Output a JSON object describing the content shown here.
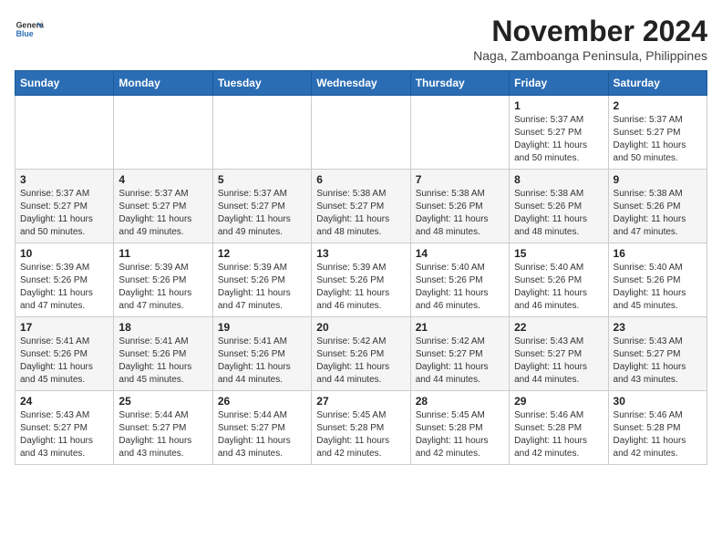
{
  "logo": {
    "general": "General",
    "blue": "Blue"
  },
  "title": "November 2024",
  "subtitle": "Naga, Zamboanga Peninsula, Philippines",
  "days_of_week": [
    "Sunday",
    "Monday",
    "Tuesday",
    "Wednesday",
    "Thursday",
    "Friday",
    "Saturday"
  ],
  "weeks": [
    [
      {
        "day": "",
        "info": ""
      },
      {
        "day": "",
        "info": ""
      },
      {
        "day": "",
        "info": ""
      },
      {
        "day": "",
        "info": ""
      },
      {
        "day": "",
        "info": ""
      },
      {
        "day": "1",
        "info": "Sunrise: 5:37 AM\nSunset: 5:27 PM\nDaylight: 11 hours and 50 minutes."
      },
      {
        "day": "2",
        "info": "Sunrise: 5:37 AM\nSunset: 5:27 PM\nDaylight: 11 hours and 50 minutes."
      }
    ],
    [
      {
        "day": "3",
        "info": "Sunrise: 5:37 AM\nSunset: 5:27 PM\nDaylight: 11 hours and 50 minutes."
      },
      {
        "day": "4",
        "info": "Sunrise: 5:37 AM\nSunset: 5:27 PM\nDaylight: 11 hours and 49 minutes."
      },
      {
        "day": "5",
        "info": "Sunrise: 5:37 AM\nSunset: 5:27 PM\nDaylight: 11 hours and 49 minutes."
      },
      {
        "day": "6",
        "info": "Sunrise: 5:38 AM\nSunset: 5:27 PM\nDaylight: 11 hours and 48 minutes."
      },
      {
        "day": "7",
        "info": "Sunrise: 5:38 AM\nSunset: 5:26 PM\nDaylight: 11 hours and 48 minutes."
      },
      {
        "day": "8",
        "info": "Sunrise: 5:38 AM\nSunset: 5:26 PM\nDaylight: 11 hours and 48 minutes."
      },
      {
        "day": "9",
        "info": "Sunrise: 5:38 AM\nSunset: 5:26 PM\nDaylight: 11 hours and 47 minutes."
      }
    ],
    [
      {
        "day": "10",
        "info": "Sunrise: 5:39 AM\nSunset: 5:26 PM\nDaylight: 11 hours and 47 minutes."
      },
      {
        "day": "11",
        "info": "Sunrise: 5:39 AM\nSunset: 5:26 PM\nDaylight: 11 hours and 47 minutes."
      },
      {
        "day": "12",
        "info": "Sunrise: 5:39 AM\nSunset: 5:26 PM\nDaylight: 11 hours and 47 minutes."
      },
      {
        "day": "13",
        "info": "Sunrise: 5:39 AM\nSunset: 5:26 PM\nDaylight: 11 hours and 46 minutes."
      },
      {
        "day": "14",
        "info": "Sunrise: 5:40 AM\nSunset: 5:26 PM\nDaylight: 11 hours and 46 minutes."
      },
      {
        "day": "15",
        "info": "Sunrise: 5:40 AM\nSunset: 5:26 PM\nDaylight: 11 hours and 46 minutes."
      },
      {
        "day": "16",
        "info": "Sunrise: 5:40 AM\nSunset: 5:26 PM\nDaylight: 11 hours and 45 minutes."
      }
    ],
    [
      {
        "day": "17",
        "info": "Sunrise: 5:41 AM\nSunset: 5:26 PM\nDaylight: 11 hours and 45 minutes."
      },
      {
        "day": "18",
        "info": "Sunrise: 5:41 AM\nSunset: 5:26 PM\nDaylight: 11 hours and 45 minutes."
      },
      {
        "day": "19",
        "info": "Sunrise: 5:41 AM\nSunset: 5:26 PM\nDaylight: 11 hours and 44 minutes."
      },
      {
        "day": "20",
        "info": "Sunrise: 5:42 AM\nSunset: 5:26 PM\nDaylight: 11 hours and 44 minutes."
      },
      {
        "day": "21",
        "info": "Sunrise: 5:42 AM\nSunset: 5:27 PM\nDaylight: 11 hours and 44 minutes."
      },
      {
        "day": "22",
        "info": "Sunrise: 5:43 AM\nSunset: 5:27 PM\nDaylight: 11 hours and 44 minutes."
      },
      {
        "day": "23",
        "info": "Sunrise: 5:43 AM\nSunset: 5:27 PM\nDaylight: 11 hours and 43 minutes."
      }
    ],
    [
      {
        "day": "24",
        "info": "Sunrise: 5:43 AM\nSunset: 5:27 PM\nDaylight: 11 hours and 43 minutes."
      },
      {
        "day": "25",
        "info": "Sunrise: 5:44 AM\nSunset: 5:27 PM\nDaylight: 11 hours and 43 minutes."
      },
      {
        "day": "26",
        "info": "Sunrise: 5:44 AM\nSunset: 5:27 PM\nDaylight: 11 hours and 43 minutes."
      },
      {
        "day": "27",
        "info": "Sunrise: 5:45 AM\nSunset: 5:28 PM\nDaylight: 11 hours and 42 minutes."
      },
      {
        "day": "28",
        "info": "Sunrise: 5:45 AM\nSunset: 5:28 PM\nDaylight: 11 hours and 42 minutes."
      },
      {
        "day": "29",
        "info": "Sunrise: 5:46 AM\nSunset: 5:28 PM\nDaylight: 11 hours and 42 minutes."
      },
      {
        "day": "30",
        "info": "Sunrise: 5:46 AM\nSunset: 5:28 PM\nDaylight: 11 hours and 42 minutes."
      }
    ]
  ]
}
